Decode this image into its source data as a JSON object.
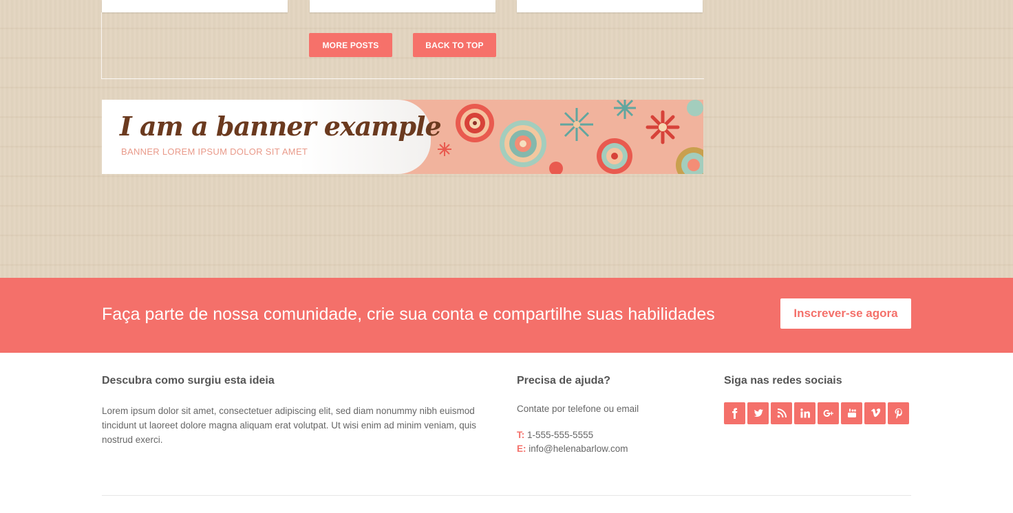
{
  "buttons": {
    "more_posts": "MORE POSTS",
    "back_to_top": "BACK TO TOP"
  },
  "banner": {
    "title": "I am a banner example",
    "subtitle": "BANNER LOREM IPSUM DOLOR SIT AMET"
  },
  "cta": {
    "text": "Faça parte de nossa comunidade, crie sua conta e compartilhe suas habilidades",
    "button": "Inscrever-se agora"
  },
  "footer": {
    "about": {
      "title": "Descubra como surgiu esta ideia",
      "text": "Lorem ipsum dolor sit amet, consectetuer adipiscing elit, sed diam nonummy nibh euismod tincidunt ut laoreet dolore magna aliquam erat volutpat. Ut wisi enim ad minim veniam, quis nostrud exerci."
    },
    "help": {
      "title": "Precisa de ajuda?",
      "intro": "Contate por telefone ou email",
      "phone_label": "T:",
      "phone": "1-555-555-5555",
      "email_label": "E:",
      "email": "info@helenabarlow.com"
    },
    "social": {
      "title": "Siga nas redes sociais",
      "icons": [
        "facebook-icon",
        "twitter-icon",
        "rss-icon",
        "linkedin-icon",
        "google-plus-icon",
        "youtube-icon",
        "vimeo-icon",
        "pinterest-icon"
      ]
    }
  },
  "colors": {
    "accent": "#f4706a",
    "wood": "#e3d5c0",
    "banner_title": "#6b3a1f"
  }
}
